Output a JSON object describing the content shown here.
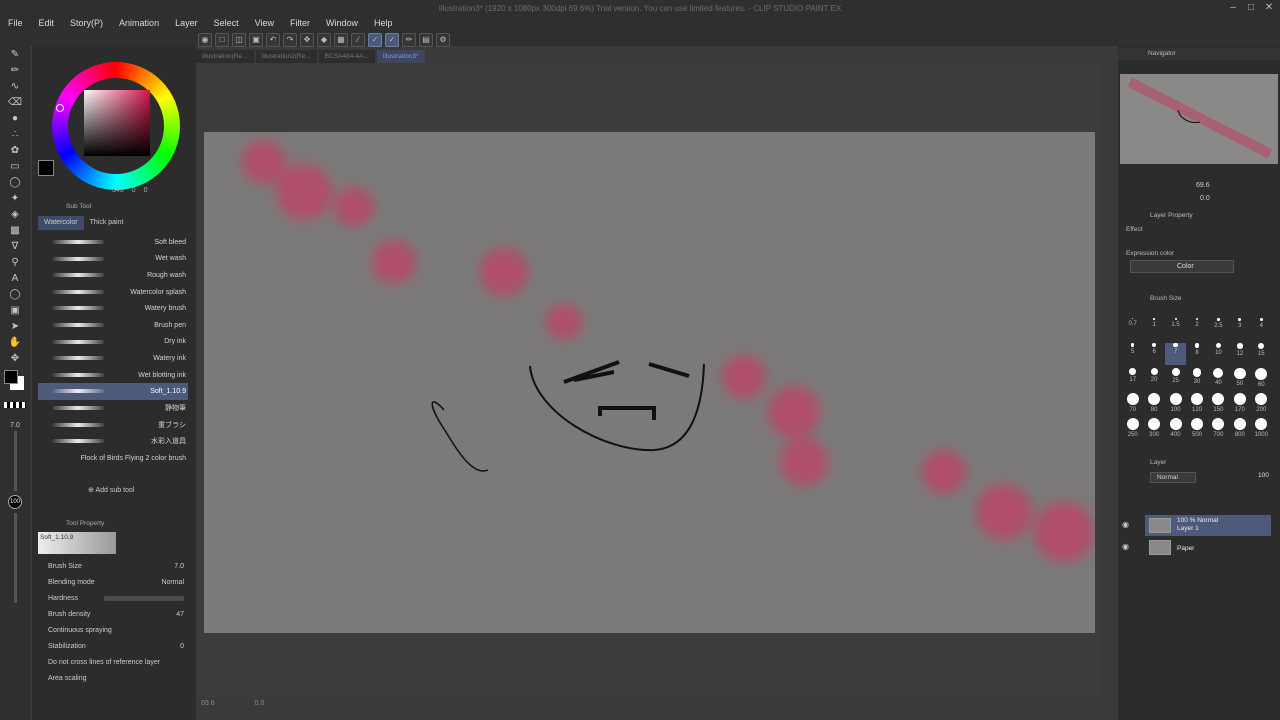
{
  "window": {
    "title": "Illustration3* (1920 x 1080px 300dpi 69.6%)  Trial version. You can use limited features. - CLIP STUDIO PAINT EX"
  },
  "menu": [
    "File",
    "Edit",
    "Story(P)",
    "Animation",
    "Layer",
    "Select",
    "View",
    "Filter",
    "Window",
    "Help"
  ],
  "tabs": [
    "Illustration(Re...",
    "Illustration2(Re...",
    "BCSA484-4A...",
    "Illustration3*"
  ],
  "color": {
    "r_value": "346",
    "g_value": "0",
    "b_value": "0",
    "accent": "#4d5a7c"
  },
  "subtool": {
    "header": "Sub Tool",
    "tabs": [
      "Watercolor",
      "Thick paint"
    ],
    "brushes": [
      "Soft bleed",
      "Wet wash",
      "Rough wash",
      "Watercolor splash",
      "Watery brush",
      "Brush pen",
      "Dry ink",
      "Watery ink",
      "Wet blotting ink",
      "Soft_1.10.9",
      "静物筆",
      "重ブラシ",
      "水彩入道具",
      "Flock of Birds Flying 2 color brush"
    ],
    "add": "Add sub tool"
  },
  "toolprop": {
    "header": "Tool Property",
    "name": "Soft_1.10.9",
    "brush_size_label": "Brush Size",
    "brush_size": "7.0",
    "blending_label": "Blending mode",
    "blending": "Normal",
    "hardness_label": "Hardness",
    "density_label": "Brush density",
    "density": "47",
    "cont_spray": "Continuous spraying",
    "stab_label": "Stabilization",
    "stab": "0",
    "cross": "Do not cross lines of reference layer",
    "area": "Area scaling"
  },
  "leftstatus": {
    "size": "7.0",
    "opacity": "100"
  },
  "status": {
    "zoom": "69.6",
    "angle": "0.0"
  },
  "navigator": {
    "title": "Navigator",
    "zoom": "69.6",
    "angle": "0.0"
  },
  "layerprop": {
    "title": "Layer Property",
    "effect": "Effect",
    "expr_label": "Expression color",
    "expr": "Color"
  },
  "brushsize": {
    "title": "Brush Size",
    "sizes": [
      "0.7",
      "1",
      "1.5",
      "2",
      "2.5",
      "3",
      "4",
      "5",
      "6",
      "7",
      "8",
      "10",
      "12",
      "15",
      "17",
      "20",
      "25",
      "30",
      "40",
      "50",
      "60",
      "70",
      "80",
      "100",
      "120",
      "150",
      "170",
      "200",
      "250",
      "300",
      "400",
      "500",
      "700",
      "800",
      "1000"
    ]
  },
  "layers": {
    "title": "Layer",
    "blend": "Normal",
    "opacity": "100",
    "rows": [
      {
        "top": "100 % Normal",
        "name": "Layer 1"
      },
      {
        "top": "",
        "name": "Paper"
      }
    ]
  }
}
